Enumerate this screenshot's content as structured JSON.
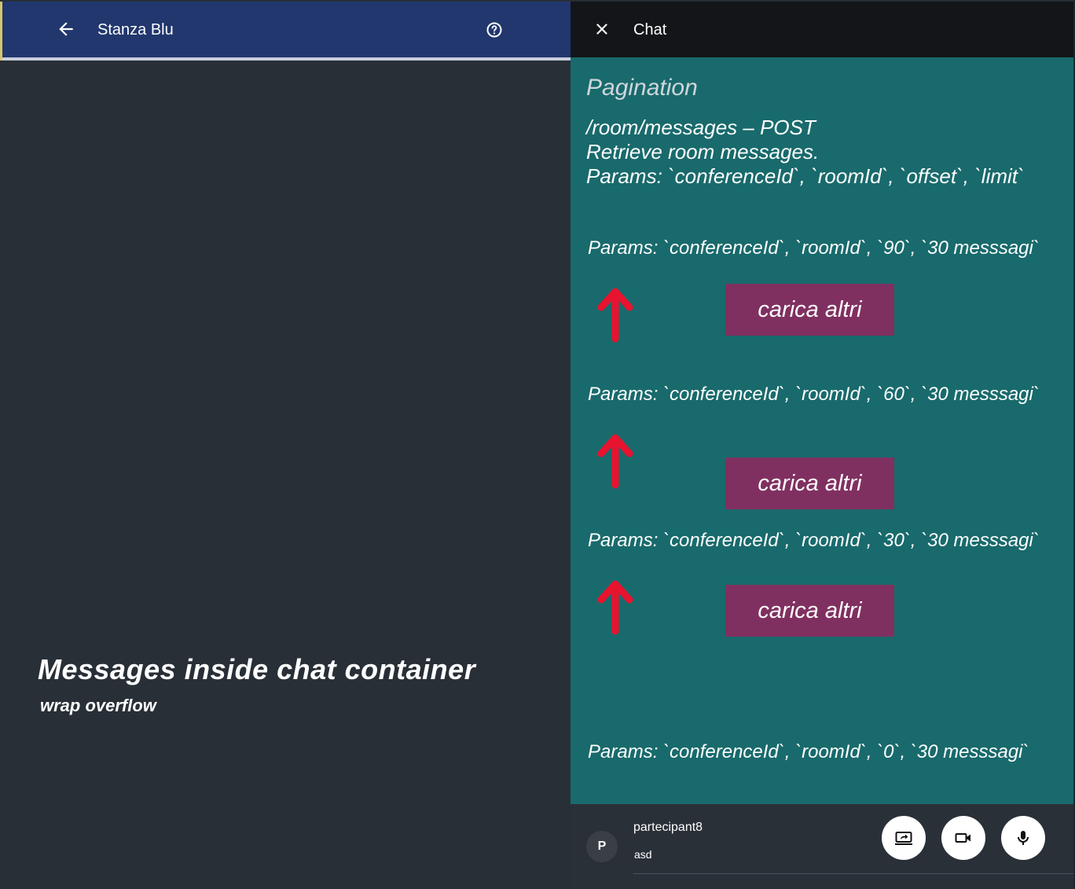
{
  "left_header": {
    "title": "Stanza Blu",
    "back_icon": "arrow-left-icon",
    "help_icon": "help-circle-icon"
  },
  "left_overlay": {
    "heading": "Messages inside chat container",
    "subheading": "wrap overflow"
  },
  "chat_header": {
    "title": "Chat",
    "close_icon": "close-icon"
  },
  "chat": {
    "pagination_title": "Pagination",
    "endpoint": "/room/messages – POST",
    "description": "Retrieve room messages.",
    "params_signature": "Params: `conferenceId`, `roomId`, `offset`, `limit`",
    "params": [
      "Params: `conferenceId`, `roomId`, `90`, `30 messsagi`",
      "Params: `conferenceId`, `roomId`, `60`, `30 messsagi`",
      "Params: `conferenceId`, `roomId`, `30`, `30 messsagi`",
      "Params: `conferenceId`, `roomId`, `0`, `30 messsagi`"
    ],
    "load_more_buttons": [
      "carica altri",
      "carica altri",
      "carica altri"
    ],
    "arrow_color": "#e8132f",
    "button_color": "#803060"
  },
  "footer": {
    "avatar_initial": "P",
    "user_name": "partecipant8",
    "message": "asd",
    "buttons": [
      "screen-share-icon",
      "video-camera-icon",
      "microphone-icon"
    ]
  },
  "colors": {
    "header_blue": "#21376e",
    "chat_teal": "#196a6c",
    "dark_bg": "#282f37"
  }
}
